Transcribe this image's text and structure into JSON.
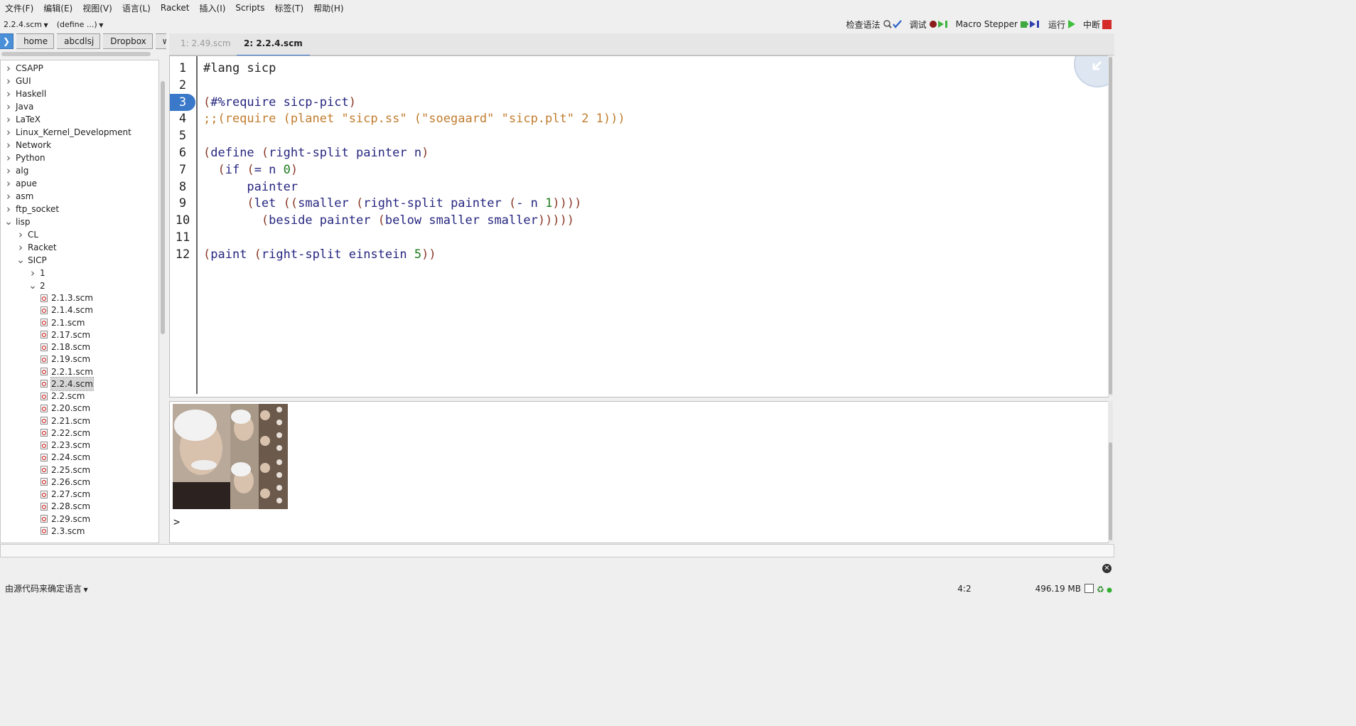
{
  "menu": [
    "文件(F)",
    "编辑(E)",
    "视图(V)",
    "语言(L)",
    "Racket",
    "插入(I)",
    "Scripts",
    "标签(T)",
    "帮助(H)"
  ],
  "toolbar": {
    "file_selector": "2.2.4.scm",
    "define_selector": "(define ...)",
    "check_syntax": "检查语法",
    "debug": "调试",
    "macro_stepper": "Macro Stepper",
    "run": "运行",
    "stop": "中断"
  },
  "breadcrumbs": [
    "home",
    "abcdlsj",
    "Dropbox",
    "workspace"
  ],
  "tree": [
    {
      "label": "CSAPP",
      "level": 0,
      "kind": "folder",
      "open": false
    },
    {
      "label": "GUI",
      "level": 0,
      "kind": "folder",
      "open": false
    },
    {
      "label": "Haskell",
      "level": 0,
      "kind": "folder",
      "open": false
    },
    {
      "label": "Java",
      "level": 0,
      "kind": "folder",
      "open": false
    },
    {
      "label": "LaTeX",
      "level": 0,
      "kind": "folder",
      "open": false
    },
    {
      "label": "Linux_Kernel_Development",
      "level": 0,
      "kind": "folder",
      "open": false
    },
    {
      "label": "Network",
      "level": 0,
      "kind": "folder",
      "open": false
    },
    {
      "label": "Python",
      "level": 0,
      "kind": "folder",
      "open": false
    },
    {
      "label": "alg",
      "level": 0,
      "kind": "folder",
      "open": false
    },
    {
      "label": "apue",
      "level": 0,
      "kind": "folder",
      "open": false
    },
    {
      "label": "asm",
      "level": 0,
      "kind": "folder",
      "open": false
    },
    {
      "label": "ftp_socket",
      "level": 0,
      "kind": "folder",
      "open": false
    },
    {
      "label": "lisp",
      "level": 0,
      "kind": "folder",
      "open": true
    },
    {
      "label": "CL",
      "level": 1,
      "kind": "folder",
      "open": false
    },
    {
      "label": "Racket",
      "level": 1,
      "kind": "folder",
      "open": false
    },
    {
      "label": "SICP",
      "level": 1,
      "kind": "folder",
      "open": true
    },
    {
      "label": "1",
      "level": 2,
      "kind": "folder",
      "open": false
    },
    {
      "label": "2",
      "level": 2,
      "kind": "folder",
      "open": true
    },
    {
      "label": "2.1.3.scm",
      "level": 3,
      "kind": "file"
    },
    {
      "label": "2.1.4.scm",
      "level": 3,
      "kind": "file"
    },
    {
      "label": "2.1.scm",
      "level": 3,
      "kind": "file"
    },
    {
      "label": "2.17.scm",
      "level": 3,
      "kind": "file"
    },
    {
      "label": "2.18.scm",
      "level": 3,
      "kind": "file"
    },
    {
      "label": "2.19.scm",
      "level": 3,
      "kind": "file"
    },
    {
      "label": "2.2.1.scm",
      "level": 3,
      "kind": "file"
    },
    {
      "label": "2.2.4.scm",
      "level": 3,
      "kind": "file",
      "selected": true
    },
    {
      "label": "2.2.scm",
      "level": 3,
      "kind": "file"
    },
    {
      "label": "2.20.scm",
      "level": 3,
      "kind": "file"
    },
    {
      "label": "2.21.scm",
      "level": 3,
      "kind": "file"
    },
    {
      "label": "2.22.scm",
      "level": 3,
      "kind": "file"
    },
    {
      "label": "2.23.scm",
      "level": 3,
      "kind": "file"
    },
    {
      "label": "2.24.scm",
      "level": 3,
      "kind": "file"
    },
    {
      "label": "2.25.scm",
      "level": 3,
      "kind": "file"
    },
    {
      "label": "2.26.scm",
      "level": 3,
      "kind": "file"
    },
    {
      "label": "2.27.scm",
      "level": 3,
      "kind": "file"
    },
    {
      "label": "2.28.scm",
      "level": 3,
      "kind": "file"
    },
    {
      "label": "2.29.scm",
      "level": 3,
      "kind": "file"
    },
    {
      "label": "2.3.scm",
      "level": 3,
      "kind": "file"
    }
  ],
  "tabs": [
    {
      "label": "1: 2.49.scm",
      "active": false
    },
    {
      "label": "2: 2.2.4.scm",
      "active": true
    }
  ],
  "editor": {
    "current_line": 3,
    "lines": [
      [
        [
          "d",
          "#lang sicp"
        ]
      ],
      [],
      [
        [
          "p",
          "("
        ],
        [
          "k",
          "#%require sicp-pict"
        ],
        [
          "p",
          ")"
        ]
      ],
      [
        [
          "c",
          ";;(require (planet \"sicp.ss\" (\"soegaard\" \"sicp.plt\" 2 1)))"
        ]
      ],
      [],
      [
        [
          "p",
          "("
        ],
        [
          "k",
          "define "
        ],
        [
          "p",
          "("
        ],
        [
          "k",
          "right-split painter n"
        ],
        [
          "p",
          ")"
        ]
      ],
      [
        [
          "d",
          "  "
        ],
        [
          "p",
          "("
        ],
        [
          "k",
          "if "
        ],
        [
          "p",
          "("
        ],
        [
          "k",
          "= n "
        ],
        [
          "n",
          "0"
        ],
        [
          "p",
          ")"
        ]
      ],
      [
        [
          "d",
          "      "
        ],
        [
          "k",
          "painter"
        ]
      ],
      [
        [
          "d",
          "      "
        ],
        [
          "p",
          "("
        ],
        [
          "k",
          "let "
        ],
        [
          "p",
          "(("
        ],
        [
          "k",
          "smaller "
        ],
        [
          "p",
          "("
        ],
        [
          "k",
          "right-split painter "
        ],
        [
          "p",
          "("
        ],
        [
          "k",
          "- n "
        ],
        [
          "n",
          "1"
        ],
        [
          "p",
          "))))"
        ]
      ],
      [
        [
          "d",
          "        "
        ],
        [
          "p",
          "("
        ],
        [
          "k",
          "beside painter "
        ],
        [
          "p",
          "("
        ],
        [
          "k",
          "below smaller smaller"
        ],
        [
          "p",
          ")))))"
        ]
      ],
      [],
      [
        [
          "p",
          "("
        ],
        [
          "k",
          "paint "
        ],
        [
          "p",
          "("
        ],
        [
          "k",
          "right-split einstein "
        ],
        [
          "n",
          "5"
        ],
        [
          "p",
          "))"
        ]
      ]
    ]
  },
  "repl": {
    "prompt": ">",
    "image": "einstein-right-split-image"
  },
  "status": {
    "language": "由源代码来确定语言",
    "position": "4:2",
    "memory": "496.19 MB"
  },
  "colors": {
    "accent": "#3e7bd6",
    "keyword": "#262680",
    "paren": "#8b3a2a",
    "comment": "#c27c2e",
    "number": "#1e7a1e"
  }
}
